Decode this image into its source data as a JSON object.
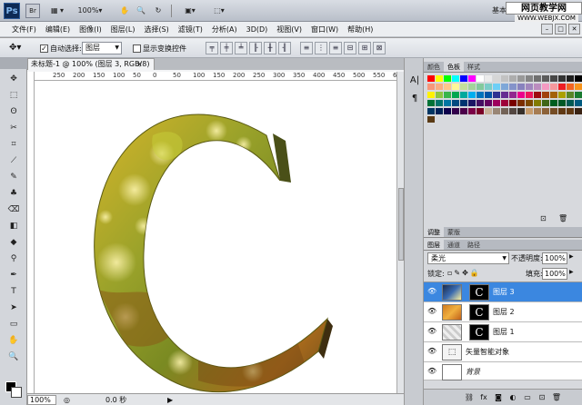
{
  "appbar": {
    "logo": "Ps",
    "br_label": "Br",
    "zoom": "100%",
    "workspace": "基本"
  },
  "watermark": {
    "line1": "网页教学网",
    "line2": "WWW.WEBJX.COM"
  },
  "menu": [
    "文件(F)",
    "编辑(E)",
    "图像(I)",
    "图层(L)",
    "选择(S)",
    "滤镜(T)",
    "分析(A)",
    "3D(D)",
    "视图(V)",
    "窗口(W)",
    "帮助(H)"
  ],
  "options": {
    "auto_select_label": "自动选择:",
    "auto_select_value": "图层",
    "show_transform_label": "显示变换控件"
  },
  "document": {
    "tab_title": "未标题-1 @ 100% (图层 3, RGB/8) *",
    "ruler_labels": [
      "250",
      "200",
      "150",
      "100",
      "50",
      "0",
      "50",
      "100",
      "150",
      "200",
      "250",
      "300",
      "350",
      "400",
      "450",
      "500",
      "550",
      "600"
    ],
    "letter": "C"
  },
  "status": {
    "zoom": "100%",
    "time": "0.0 秒"
  },
  "swatches_tabs": [
    "颜色",
    "色板",
    "样式"
  ],
  "adjust_tabs": [
    "调整",
    "蒙版"
  ],
  "layers_tabs": [
    "图层",
    "通道",
    "路径"
  ],
  "layers": {
    "blend_mode": "柔光",
    "opacity_label": "不透明度:",
    "opacity": "100%",
    "lock_label": "锁定:",
    "fill_label": "填充:",
    "fill": "100%",
    "items": [
      {
        "name": "图层 3",
        "selected": true
      },
      {
        "name": "图层 2",
        "selected": false
      },
      {
        "name": "图层 1",
        "selected": false
      },
      {
        "name": "矢量智能对象",
        "selected": false
      },
      {
        "name": "背景",
        "selected": false
      }
    ]
  },
  "colors": {
    "selection": "#3b87e0",
    "letter_gold": "#b59a1a",
    "letter_green": "#5a7a2a"
  }
}
